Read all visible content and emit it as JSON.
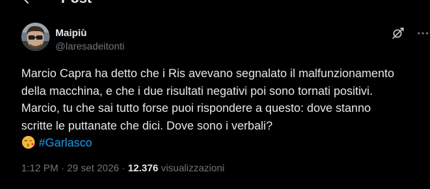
{
  "header": {
    "title": "Post",
    "back_icon": "arrow-left-icon"
  },
  "tweet": {
    "author": {
      "display_name": "Maipiù",
      "handle": "@laresadeitonti"
    },
    "icons": {
      "grok": "grok-icon",
      "more": "more-icon"
    },
    "text_lines": [
      "Marcio Capra ha detto che i Ris avevano segnalato il malfunzionamento",
      "della macchina, e che i due risultati negativi poi sono tornati positivi.",
      "Marcio, tu che sai tutto forse puoi rispondere a questo: dove stanno",
      "scritte le puttanate che dici. Dove sono i verbali?"
    ],
    "emoji": "kissing-face-emoji",
    "hashtag": "#Garlasco",
    "time": "1:12 PM",
    "dot": "·",
    "date": "29 set 2026",
    "views_count": "12.376",
    "views_label": "visualizzazioni"
  },
  "colors": {
    "background": "#000000",
    "text": "#e7e9ea",
    "secondary": "#71767b",
    "link": "#1d9bf0"
  }
}
